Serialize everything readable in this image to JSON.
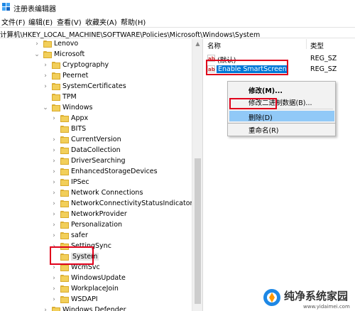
{
  "window": {
    "title": "注册表编辑器"
  },
  "menu": {
    "file": "文件(F)",
    "edit": "编辑(E)",
    "view": "查看(V)",
    "favorites": "收藏夹(A)",
    "help": "帮助(H)"
  },
  "address": {
    "path": "计算机\\HKEY_LOCAL_MACHINE\\SOFTWARE\\Policies\\Microsoft\\Windows\\System"
  },
  "tree": {
    "items": [
      {
        "label": "Lenovo",
        "chevron": "›",
        "selected": false
      },
      {
        "label": "Microsoft",
        "chevron": "⌄",
        "selected": false
      },
      {
        "label": "Cryptography",
        "chevron": "›",
        "selected": false
      },
      {
        "label": "Peernet",
        "chevron": "›",
        "selected": false
      },
      {
        "label": "SystemCertificates",
        "chevron": "›",
        "selected": false
      },
      {
        "label": "TPM",
        "chevron": "",
        "selected": false
      },
      {
        "label": "Windows",
        "chevron": "⌄",
        "selected": false
      },
      {
        "label": "Appx",
        "chevron": "›",
        "selected": false
      },
      {
        "label": "BITS",
        "chevron": "",
        "selected": false
      },
      {
        "label": "CurrentVersion",
        "chevron": "›",
        "selected": false
      },
      {
        "label": "DataCollection",
        "chevron": "›",
        "selected": false
      },
      {
        "label": "DriverSearching",
        "chevron": "›",
        "selected": false
      },
      {
        "label": "EnhancedStorageDevices",
        "chevron": "›",
        "selected": false
      },
      {
        "label": "IPSec",
        "chevron": "›",
        "selected": false
      },
      {
        "label": "Network Connections",
        "chevron": "›",
        "selected": false
      },
      {
        "label": "NetworkConnectivityStatusIndicator",
        "chevron": "›",
        "selected": false
      },
      {
        "label": "NetworkProvider",
        "chevron": "›",
        "selected": false
      },
      {
        "label": "Personalization",
        "chevron": "›",
        "selected": false
      },
      {
        "label": "safer",
        "chevron": "›",
        "selected": false
      },
      {
        "label": "SettingSync",
        "chevron": "›",
        "selected": false
      },
      {
        "label": "System",
        "chevron": "",
        "selected": true
      },
      {
        "label": "WcmSvc",
        "chevron": "›",
        "selected": false
      },
      {
        "label": "WindowsUpdate",
        "chevron": "›",
        "selected": false
      },
      {
        "label": "WorkplaceJoin",
        "chevron": "›",
        "selected": false
      },
      {
        "label": "WSDAPI",
        "chevron": "›",
        "selected": false
      },
      {
        "label": "Windows Defender",
        "chevron": "›",
        "selected": false
      }
    ]
  },
  "values": {
    "col_name": "名称",
    "col_type": "类型",
    "rows": [
      {
        "icon": "ab",
        "name": "(默认)",
        "type": "REG_SZ",
        "selected": false
      },
      {
        "icon": "ab",
        "name": "Enable SmartScreen",
        "type": "REG_SZ",
        "selected": true
      }
    ]
  },
  "context_menu": {
    "items": [
      {
        "label": "修改(M)...",
        "bold": true,
        "highlight": false
      },
      {
        "label": "修改二进制数据(B)...",
        "bold": false,
        "highlight": false
      },
      {
        "label": "删除(D)",
        "bold": false,
        "highlight": true
      },
      {
        "label": "重命名(R)",
        "bold": false,
        "highlight": false
      }
    ]
  },
  "watermark": {
    "title": "纯净系统家园",
    "url": "www.yidaimei.com"
  },
  "colors": {
    "selection": "#0078d7",
    "menu_highlight": "#91c9f7",
    "annotation": "#e0001b",
    "folder": "#f2cf5a"
  }
}
